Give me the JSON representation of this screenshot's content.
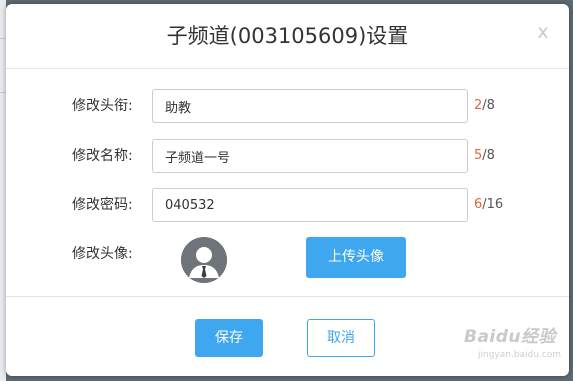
{
  "dialog": {
    "title": "子频道(003105609)设置",
    "close_label": "x"
  },
  "form": {
    "title_row": {
      "label": "修改头衔:",
      "value": "助教",
      "count_current": "2",
      "count_max": "/8"
    },
    "name_row": {
      "label": "修改名称:",
      "value": "子频道一号",
      "count_current": "5",
      "count_max": "/8"
    },
    "password_row": {
      "label": "修改密码:",
      "value": "040532",
      "count_current": "6",
      "count_max": "/16"
    },
    "avatar_row": {
      "label": "修改头像:",
      "upload_label": "上传头像",
      "avatar_icon": "user-avatar-icon"
    }
  },
  "footer": {
    "save_label": "保存",
    "cancel_label": "取消"
  },
  "watermark": {
    "text": "Baidu经验",
    "url": "jingyan.baidu.com"
  },
  "colors": {
    "accent": "#3fa6f0",
    "count_highlight": "#e4643a",
    "overlay": "#5f6a72"
  }
}
